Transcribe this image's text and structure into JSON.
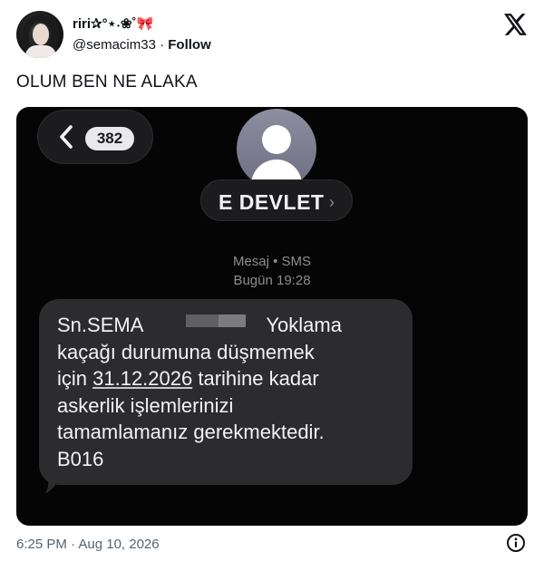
{
  "author": {
    "display_name": "riri✰°⋆˖❀˚🎀",
    "handle": "@semacim33",
    "separator": "·",
    "follow_label": "Follow"
  },
  "tweet": {
    "text": "OLUM BEN NE ALAKA",
    "timestamp": "6:25 PM · Aug 10, 2026"
  },
  "sms": {
    "unread_count": "382",
    "contact_name": "E DEVLET",
    "contact_chevron": "›",
    "meta_type": "Mesaj • SMS",
    "meta_time": "Bugün 19:28",
    "message": {
      "line1_start": "Sn.SEMA",
      "line1_end": "Yoklama",
      "line2": "kaçağı durumuna düşmemek",
      "line3_start": "için ",
      "line3_date": "31.12.2026",
      "line3_end": " tarihine kadar",
      "line4": "askerlik işlemlerinizi",
      "line5": "tamamlamanız gerekmektedir.",
      "line6": "B016"
    }
  },
  "colors": {
    "accent_text": "#0f1419",
    "secondary_text": "#536471",
    "sms_bubble": "#2c2c2e",
    "sms_background": "#050505",
    "meta_gray": "#8e8e93"
  },
  "icons": [
    "x-logo-icon",
    "back-chevron-icon",
    "contact-person-icon",
    "info-icon"
  ]
}
